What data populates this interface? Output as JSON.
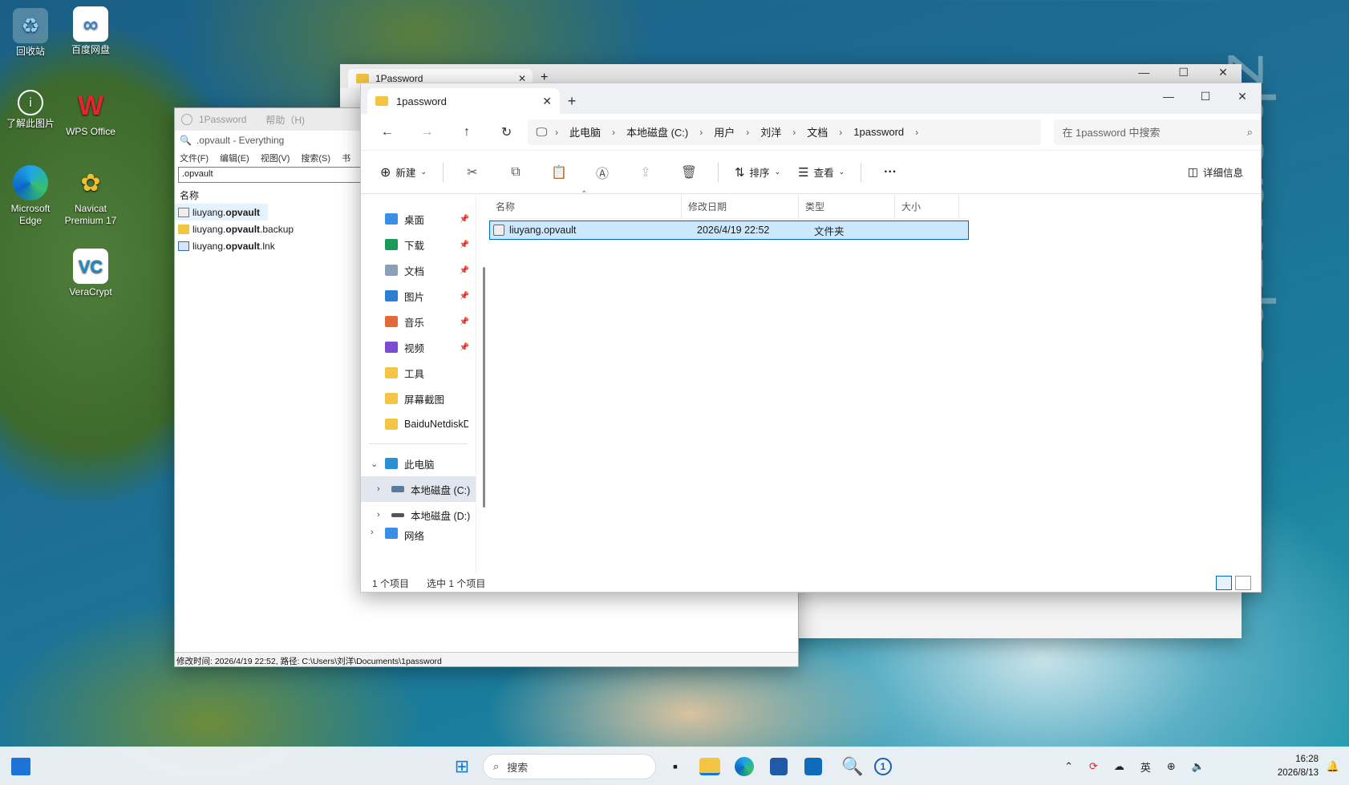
{
  "desktop": {
    "icons": [
      {
        "label": "回收站"
      },
      {
        "label": "百度网盘"
      },
      {
        "label": "了解此图片"
      },
      {
        "label": "WPS Office"
      },
      {
        "label": "Microsoft Edge"
      },
      {
        "label": "Navicat Premium 17"
      },
      {
        "label": "VeraCrypt"
      }
    ],
    "watermark": "zhenxzhe"
  },
  "onepassword_ghost": {
    "title": "1Password",
    "menu_help": "帮助（H)"
  },
  "everything": {
    "title": ".opvault - Everything",
    "menus": [
      "文件(F)",
      "编辑(E)",
      "视图(V)",
      "搜索(S)",
      "书"
    ],
    "search_value": ".opvault",
    "column_name": "名称",
    "results": [
      {
        "prefix": "liuyang.",
        "match": "opvault",
        "suffix": ""
      },
      {
        "prefix": "liuyang.",
        "match": "opvault",
        "suffix": ".backup"
      },
      {
        "prefix": "liuyang.",
        "match": "opvault",
        "suffix": ".lnk"
      }
    ],
    "status": "修改时间: 2026/4/19 22:52, 路径: C:\\Users\\刘洋\\Documents\\1password"
  },
  "back_explorer": {
    "tab_title": "1Password"
  },
  "explorer": {
    "tab_title": "1password",
    "breadcrumb": [
      "此电脑",
      "本地磁盘 (C:)",
      "用户",
      "刘洋",
      "文档",
      "1password"
    ],
    "search_placeholder": "在 1password 中搜索",
    "commands": {
      "new": "新建",
      "sort": "排序",
      "view": "查看",
      "details": "详细信息"
    },
    "nav_quick": [
      {
        "label": "桌面",
        "icon": "desktop-icon",
        "color": "#3a8ee6",
        "pinned": true
      },
      {
        "label": "下载",
        "icon": "download-icon",
        "color": "#1c9a5a",
        "pinned": true
      },
      {
        "label": "文档",
        "icon": "document-icon",
        "color": "#8ca0b8",
        "pinned": true
      },
      {
        "label": "图片",
        "icon": "pictures-icon",
        "color": "#2d7fd3",
        "pinned": true
      },
      {
        "label": "音乐",
        "icon": "music-icon",
        "color": "#e3693a",
        "pinned": true
      },
      {
        "label": "视频",
        "icon": "video-icon",
        "color": "#7b4bd1",
        "pinned": true
      },
      {
        "label": "工具",
        "icon": "folder-icon",
        "color": "#f4c542",
        "pinned": false
      },
      {
        "label": "屏幕截图",
        "icon": "folder-icon",
        "color": "#f4c542",
        "pinned": false
      },
      {
        "label": "BaiduNetdiskD",
        "icon": "folder-icon",
        "color": "#f4c542",
        "pinned": false
      }
    ],
    "nav_pc": {
      "label": "此电脑"
    },
    "nav_drives": [
      {
        "label": "本地磁盘 (C:)",
        "selected": true
      },
      {
        "label": "本地磁盘 (D:)",
        "selected": false
      }
    ],
    "nav_network": "网络",
    "columns": {
      "name": "名称",
      "modified": "修改日期",
      "type": "类型",
      "size": "大小"
    },
    "files": [
      {
        "name": "liuyang.opvault",
        "modified": "2026/4/19 22:52",
        "type": "文件夹",
        "size": ""
      }
    ],
    "status_count": "1 个项目",
    "status_selected": "选中 1 个项目"
  },
  "taskbar": {
    "search_label": "搜索",
    "ime": "英",
    "time": "16:28",
    "date": "2026/8/13"
  }
}
